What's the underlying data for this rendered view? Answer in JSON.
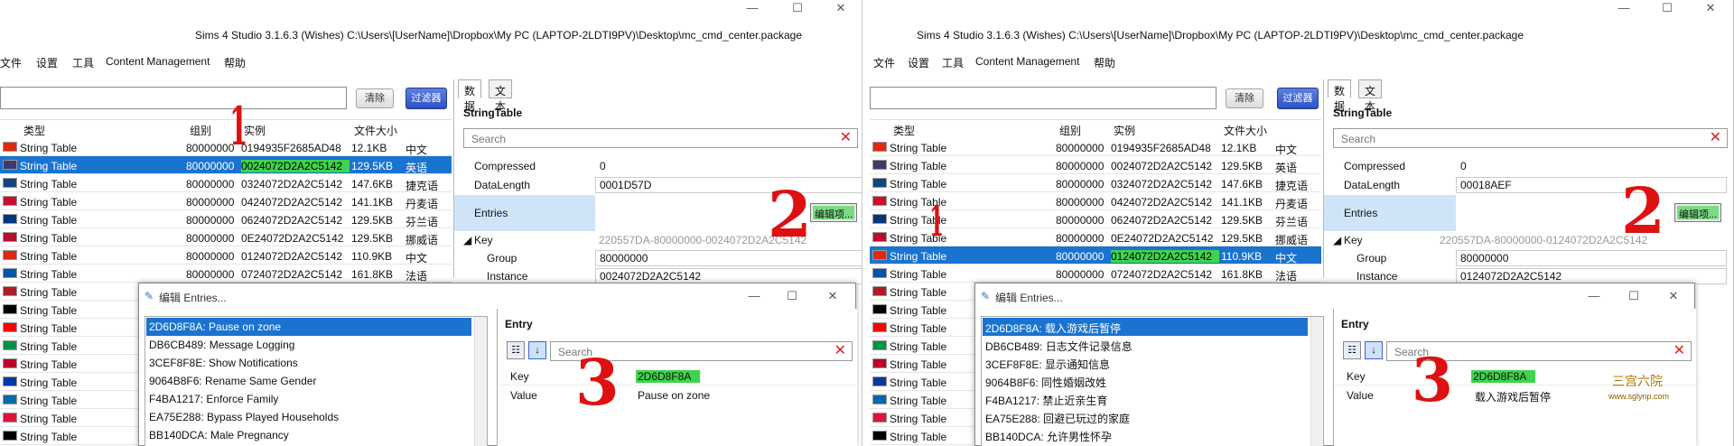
{
  "left": {
    "title": "Sims 4 Studio 3.1.6.3 (Wishes)  C:\\Users\\[UserName]\\Dropbox\\My PC (LAPTOP-2LDTI9PV)\\Desktop\\mc_cmd_center.package",
    "menu": [
      "文件",
      "设置",
      "工具",
      "Content Management",
      "帮助"
    ],
    "clear_label": "清除",
    "filter_label": "过滤器",
    "columns": {
      "type": "类型",
      "group": "组别",
      "instance": "实例",
      "size": "文件大小"
    },
    "rows": [
      {
        "type": "String Table",
        "group": "80000000",
        "instance": "0194935F2685AD48",
        "size": "12.1KB",
        "lang": "中文",
        "flag": "#de2910"
      },
      {
        "type": "String Table",
        "group": "80000000",
        "instance": "0024072D2A2C5142",
        "size": "129.5KB",
        "lang": "英语",
        "flag": "#3c3b6e"
      },
      {
        "type": "String Table",
        "group": "80000000",
        "instance": "0324072D2A2C5142",
        "size": "147.6KB",
        "lang": "捷克语",
        "flag": "#11457e"
      },
      {
        "type": "String Table",
        "group": "80000000",
        "instance": "0424072D2A2C5142",
        "size": "141.1KB",
        "lang": "丹麦语",
        "flag": "#c8102e"
      },
      {
        "type": "String Table",
        "group": "80000000",
        "instance": "0624072D2A2C5142",
        "size": "129.5KB",
        "lang": "芬兰语",
        "flag": "#003580"
      },
      {
        "type": "String Table",
        "group": "80000000",
        "instance": "0E24072D2A2C5142",
        "size": "129.5KB",
        "lang": "挪威语",
        "flag": "#ba0c2f"
      },
      {
        "type": "String Table",
        "group": "80000000",
        "instance": "0124072D2A2C5142",
        "size": "110.9KB",
        "lang": "中文",
        "flag": "#de2910"
      },
      {
        "type": "String Table",
        "group": "80000000",
        "instance": "0724072D2A2C5142",
        "size": "161.8KB",
        "lang": "法语",
        "flag": "#0055a4"
      },
      {
        "type": "String Table",
        "group": "",
        "instance": "",
        "size": "",
        "lang": "",
        "flag": "#ae1c28"
      },
      {
        "type": "String Table",
        "group": "",
        "instance": "",
        "size": "",
        "lang": "",
        "flag": "#000000"
      },
      {
        "type": "String Table",
        "group": "",
        "instance": "",
        "size": "",
        "lang": "",
        "flag": "#ff0000"
      },
      {
        "type": "String Table",
        "group": "",
        "instance": "",
        "size": "",
        "lang": "",
        "flag": "#009246"
      },
      {
        "type": "String Table",
        "group": "",
        "instance": "",
        "size": "",
        "lang": "",
        "flag": "#bc002d"
      },
      {
        "type": "String Table",
        "group": "",
        "instance": "",
        "size": "",
        "lang": "",
        "flag": "#0039a6"
      },
      {
        "type": "String Table",
        "group": "",
        "instance": "",
        "size": "",
        "lang": "",
        "flag": "#006aa7"
      },
      {
        "type": "String Table",
        "group": "",
        "instance": "",
        "size": "",
        "lang": "",
        "flag": "#dc143c"
      },
      {
        "type": "String Table",
        "group": "",
        "instance": "",
        "size": "",
        "lang": "",
        "flag": "#000000"
      }
    ],
    "panel": {
      "tab_data": "数据",
      "tab_text": "文本",
      "title": "StringTable",
      "search_placeholder": "Search",
      "compressed_label": "Compressed",
      "compressed_value": "0",
      "datalength_label": "DataLength",
      "datalength_value": "0001D57D",
      "entries_label": "Entries",
      "edit_label": "编辑项...",
      "key_label": "Key",
      "key_value": "220557DA-80000000-0024072D2A2C5142",
      "group_label": "Group",
      "group_value": "80000000",
      "instance_label": "Instance",
      "instance_value": "0024072D2A2C5142"
    },
    "dialog": {
      "title": "编辑 Entries...",
      "items": [
        "2D6D8F8A: Pause on zone",
        "DB6CB489: Message Logging",
        "3CEF8F8E: Show Notifications",
        "9064B8F6: Rename Same Gender",
        "F4BA1217: Enforce Family",
        "EA75E288: Bypass Played Households",
        "BB140DCA: Male Pregnancy"
      ],
      "entry_title": "Entry",
      "search_placeholder": "Search",
      "key_label": "Key",
      "key_value": "2D6D8F8A",
      "value_label": "Value",
      "value_value": "Pause on zone"
    },
    "annotations": [
      "1",
      "2",
      "3"
    ]
  },
  "right": {
    "title": "Sims 4 Studio 3.1.6.3 (Wishes)  C:\\Users\\[UserName]\\Dropbox\\My PC (LAPTOP-2LDTI9PV)\\Desktop\\mc_cmd_center.package",
    "menu": [
      "文件",
      "设置",
      "工具",
      "Content Management",
      "帮助"
    ],
    "clear_label": "清除",
    "filter_label": "过滤器",
    "columns": {
      "type": "类型",
      "group": "组别",
      "instance": "实例",
      "size": "文件大小"
    },
    "rows": [
      {
        "type": "String Table",
        "group": "80000000",
        "instance": "0194935F2685AD48",
        "size": "12.1KB",
        "lang": "中文",
        "flag": "#de2910"
      },
      {
        "type": "String Table",
        "group": "80000000",
        "instance": "0024072D2A2C5142",
        "size": "129.5KB",
        "lang": "英语",
        "flag": "#3c3b6e"
      },
      {
        "type": "String Table",
        "group": "80000000",
        "instance": "0324072D2A2C5142",
        "size": "147.6KB",
        "lang": "捷克语",
        "flag": "#11457e"
      },
      {
        "type": "String Table",
        "group": "80000000",
        "instance": "0424072D2A2C5142",
        "size": "141.1KB",
        "lang": "丹麦语",
        "flag": "#c8102e"
      },
      {
        "type": "String Table",
        "group": "80000000",
        "instance": "0624072D2A2C5142",
        "size": "129.5KB",
        "lang": "芬兰语",
        "flag": "#003580"
      },
      {
        "type": "String Table",
        "group": "80000000",
        "instance": "0E24072D2A2C5142",
        "size": "129.5KB",
        "lang": "挪威语",
        "flag": "#ba0c2f"
      },
      {
        "type": "String Table",
        "group": "80000000",
        "instance": "0124072D2A2C5142",
        "size": "110.9KB",
        "lang": "中文",
        "flag": "#de2910"
      },
      {
        "type": "String Table",
        "group": "80000000",
        "instance": "0724072D2A2C5142",
        "size": "161.8KB",
        "lang": "法语",
        "flag": "#0055a4"
      },
      {
        "type": "String Table",
        "group": "",
        "instance": "",
        "size": "",
        "lang": "",
        "flag": "#ae1c28"
      },
      {
        "type": "String Table",
        "group": "",
        "instance": "",
        "size": "",
        "lang": "",
        "flag": "#000000"
      },
      {
        "type": "String Table",
        "group": "",
        "instance": "",
        "size": "",
        "lang": "",
        "flag": "#ff0000"
      },
      {
        "type": "String Table",
        "group": "",
        "instance": "",
        "size": "",
        "lang": "",
        "flag": "#009246"
      },
      {
        "type": "String Table",
        "group": "",
        "instance": "",
        "size": "",
        "lang": "",
        "flag": "#bc002d"
      },
      {
        "type": "String Table",
        "group": "",
        "instance": "",
        "size": "",
        "lang": "",
        "flag": "#0039a6"
      },
      {
        "type": "String Table",
        "group": "",
        "instance": "",
        "size": "",
        "lang": "",
        "flag": "#006aa7"
      },
      {
        "type": "String Table",
        "group": "",
        "instance": "",
        "size": "",
        "lang": "",
        "flag": "#dc143c"
      },
      {
        "type": "String Table",
        "group": "",
        "instance": "",
        "size": "",
        "lang": "",
        "flag": "#000000"
      }
    ],
    "panel": {
      "tab_data": "数据",
      "tab_text": "文本",
      "title": "StringTable",
      "search_placeholder": "Search",
      "compressed_label": "Compressed",
      "compressed_value": "0",
      "datalength_label": "DataLength",
      "datalength_value": "00018AEF",
      "entries_label": "Entries",
      "edit_label": "编辑项...",
      "key_label": "Key",
      "key_value": "220557DA-80000000-0124072D2A2C5142",
      "group_label": "Group",
      "group_value": "80000000",
      "instance_label": "Instance",
      "instance_value": "0124072D2A2C5142"
    },
    "dialog": {
      "title": "编辑 Entries...",
      "items": [
        "2D6D8F8A: 载入游戏后暂停",
        "DB6CB489: 日志文件记录信息",
        "3CEF8F8E: 显示通知信息",
        "9064B8F6: 同性婚姻改姓",
        "F4BA1217: 禁止近亲生育",
        "EA75E288: 回避已玩过的家庭",
        "BB140DCA: 允许男性怀孕"
      ],
      "entry_title": "Entry",
      "search_placeholder": "Search",
      "key_label": "Key",
      "key_value": "2D6D8F8A",
      "value_label": "Value",
      "value_value": "载入游戏后暂停"
    },
    "annotations": [
      "1",
      "2",
      "3"
    ],
    "watermark_title": "三宫六院",
    "watermark_url": "www.sglynp.com"
  },
  "colors": {
    "selection": "#1b73d0",
    "highlight": "#3fd44d",
    "annotation": "#dd1111",
    "filter_button": "#2d52c4"
  }
}
